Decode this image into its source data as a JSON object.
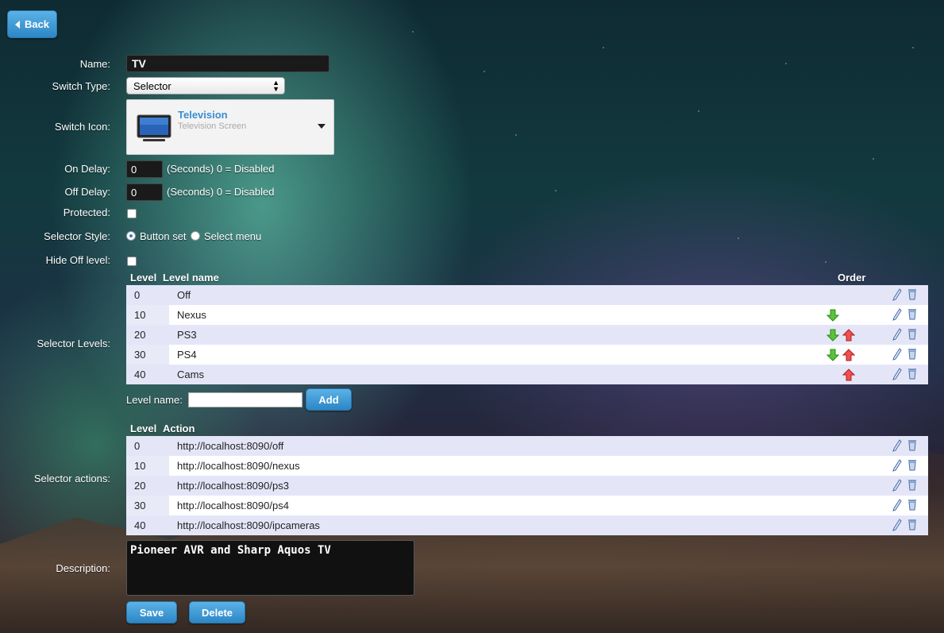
{
  "back_label": "Back",
  "labels": {
    "name": "Name:",
    "switch_type": "Switch Type:",
    "switch_icon": "Switch Icon:",
    "on_delay": "On Delay:",
    "off_delay": "Off Delay:",
    "protected": "Protected:",
    "selector_style": "Selector Style:",
    "hide_off_level": "Hide Off level:",
    "selector_levels": "Selector Levels:",
    "selector_actions": "Selector actions:",
    "description": "Description:"
  },
  "name_value": "TV",
  "switch_type_value": "Selector",
  "icon": {
    "title": "Television",
    "subtitle": "Television Screen",
    "name": "tv-icon"
  },
  "on_delay": {
    "value": "0",
    "hint": "(Seconds) 0 = Disabled"
  },
  "off_delay": {
    "value": "0",
    "hint": "(Seconds) 0 = Disabled"
  },
  "protected_checked": false,
  "selector_style": {
    "options": [
      "Button set",
      "Select menu"
    ],
    "selected": "Button set"
  },
  "hide_off_checked": false,
  "levels_table": {
    "headers": {
      "level": "Level",
      "name": "Level name",
      "order": "Order"
    },
    "rows": [
      {
        "level": "0",
        "name": "Off",
        "down": false,
        "up": false
      },
      {
        "level": "10",
        "name": "Nexus",
        "down": true,
        "up": false
      },
      {
        "level": "20",
        "name": "PS3",
        "down": true,
        "up": true
      },
      {
        "level": "30",
        "name": "PS4",
        "down": true,
        "up": true
      },
      {
        "level": "40",
        "name": "Cams",
        "down": false,
        "up": true
      }
    ]
  },
  "level_name_label": "Level name:",
  "level_name_value": "",
  "add_label": "Add",
  "actions_table": {
    "headers": {
      "level": "Level",
      "action": "Action"
    },
    "rows": [
      {
        "level": "0",
        "action": "http://localhost:8090/off"
      },
      {
        "level": "10",
        "action": "http://localhost:8090/nexus"
      },
      {
        "level": "20",
        "action": "http://localhost:8090/ps3"
      },
      {
        "level": "30",
        "action": "http://localhost:8090/ps4"
      },
      {
        "level": "40",
        "action": "http://localhost:8090/ipcameras"
      }
    ]
  },
  "description_value": "Pioneer AVR and Sharp Aquos TV",
  "save_label": "Save",
  "delete_label": "Delete",
  "colors": {
    "button": "#2d86c6",
    "row_alt": "#e4e6f8",
    "icon_title": "#3a8ed0"
  }
}
